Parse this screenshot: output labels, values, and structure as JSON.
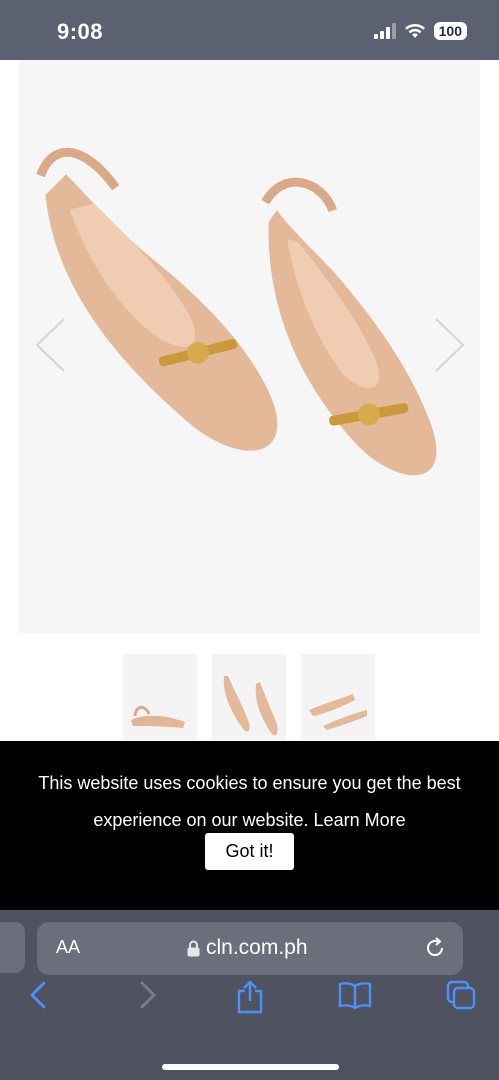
{
  "status_bar": {
    "time": "9:08",
    "battery": "100"
  },
  "cookie_banner": {
    "message_line1": "This website uses cookies to ensure you get the best",
    "message_line2_prefix": "experience on our website.",
    "learn_more": "Learn More",
    "button_label": "Got it!"
  },
  "browser": {
    "text_size_label": "AA",
    "url": "cln.com.ph"
  },
  "colors": {
    "status_bar": "#5c6171",
    "browser_bar": "#4f5360",
    "accent_blue": "#4a90ff",
    "banner_bg": "#000000"
  },
  "icons": {
    "image_prev": "chevron-left-icon",
    "image_next": "chevron-right-icon",
    "lock": "lock-icon",
    "reload": "reload-icon",
    "back": "back-icon",
    "forward": "forward-icon",
    "share": "share-icon",
    "bookmarks": "bookmarks-icon",
    "tabs": "tabs-icon"
  }
}
